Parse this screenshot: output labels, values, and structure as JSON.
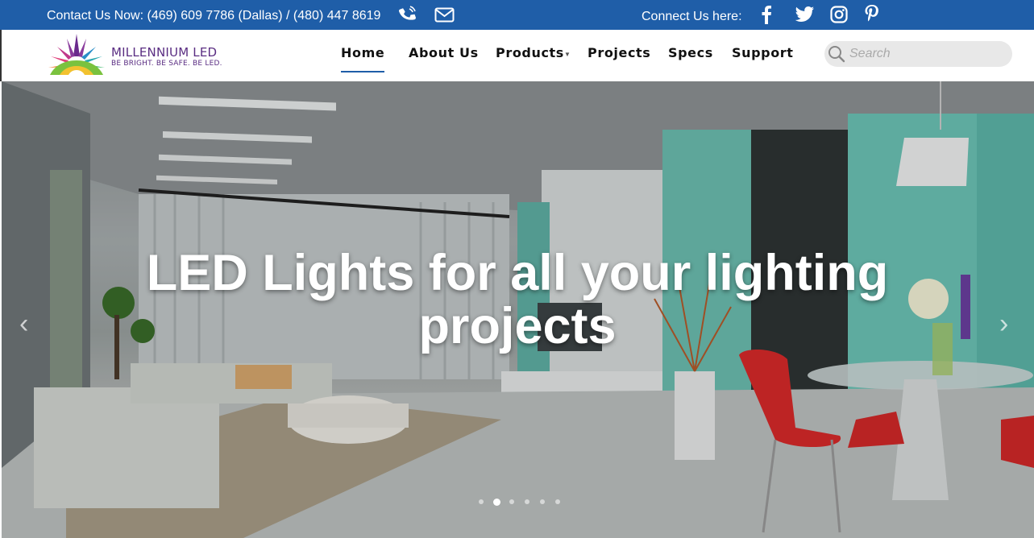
{
  "topbar": {
    "contact_text": "Contact Us Now: (469) 609 7786 (Dallas) / (480) 447 8619",
    "connect_text": "Connect Us here:",
    "bg_color": "#1f5ea8",
    "icons": [
      "phone-icon",
      "mail-icon",
      "facebook-icon",
      "twitter-icon",
      "instagram-icon",
      "pinterest-icon"
    ]
  },
  "logo": {
    "name": "MILLENNIUM LED",
    "tagline": "BE BRIGHT. BE SAFE. BE LED."
  },
  "nav": {
    "items": [
      {
        "label": "Home",
        "active": true
      },
      {
        "label": "About Us"
      },
      {
        "label": "Products",
        "has_dropdown": true
      },
      {
        "label": "Projects"
      },
      {
        "label": "Specs"
      },
      {
        "label": "Support"
      }
    ],
    "active_color": "#1f5ea8"
  },
  "search": {
    "placeholder": "Search"
  },
  "hero": {
    "headline": "LED Lights for all your lighting projects",
    "slide_count": 6,
    "active_slide": 2
  }
}
